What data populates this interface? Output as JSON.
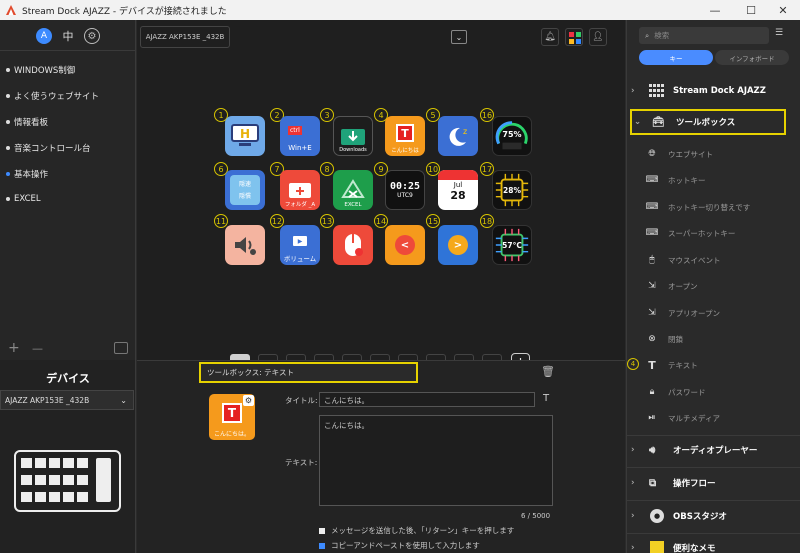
{
  "window": {
    "title": "Stream Dock AJAZZ - デバイスが接続されました",
    "min": "—",
    "max": "☐",
    "close": "✕"
  },
  "sidebar": {
    "items": [
      {
        "label": "WINDOWS制御",
        "active": false
      },
      {
        "label": "よく使うウェブサイト",
        "active": false
      },
      {
        "label": "情報看板",
        "active": false
      },
      {
        "label": "音楽コントロール台",
        "active": false
      },
      {
        "label": "基本操作",
        "active": true
      },
      {
        "label": "EXCEL",
        "active": false
      }
    ],
    "add": "+",
    "remove": "—"
  },
  "device_panel": {
    "heading": "デバイス",
    "device_select": "AJAZZ AKP153E _432B"
  },
  "toolbar": {
    "device_tab": "AJAZZ AKP153E _432B"
  },
  "keys": [
    {
      "num": "1",
      "label": ""
    },
    {
      "num": "2",
      "label": "Win+E",
      "top": "ctrl"
    },
    {
      "num": "3",
      "label": "Downloads"
    },
    {
      "num": "4",
      "label": "こんにちは",
      "glyph": "T"
    },
    {
      "num": "5",
      "label": ""
    },
    {
      "num": "16",
      "label": "75%"
    },
    {
      "num": "6",
      "label": "",
      "line1": "隠速",
      "line2": "隠慣"
    },
    {
      "num": "7",
      "label": "フォルダ _A"
    },
    {
      "num": "8",
      "label": "EXCEL"
    },
    {
      "num": "9",
      "label": "UTC9",
      "time": "00:25"
    },
    {
      "num": "10",
      "label": "28",
      "month": "Jul"
    },
    {
      "num": "17",
      "label": "28%"
    },
    {
      "num": "11",
      "label": ""
    },
    {
      "num": "12",
      "label": "ボリューム"
    },
    {
      "num": "13",
      "label": ""
    },
    {
      "num": "14",
      "label": "<"
    },
    {
      "num": "15",
      "label": ">"
    },
    {
      "num": "18",
      "label": "57°C"
    }
  ],
  "pages": [
    "1",
    "2",
    "3",
    "4",
    "5",
    "6",
    "7",
    "8",
    "9",
    "10"
  ],
  "page_add": "+",
  "editor": {
    "header": "ツールボックス: テキスト",
    "title_label": "タイトル:",
    "title_value": "こんにちは。",
    "text_label": "テキスト:",
    "text_value": "こんにちは。",
    "counter": "6 / 5000",
    "opt1": "メッセージを送信した後、「リターン」キーを押します",
    "opt2": "コピーアンドペーストを使用して入力します",
    "preview_label": "こんにちは。",
    "tbtn": "T"
  },
  "right": {
    "search_placeholder": "検索",
    "tab_key": "キー",
    "tab_info": "インフォボード",
    "sections": [
      "Stream Dock AJAZZ",
      "ツールボックス",
      "オーディオプレーヤー",
      "操作フロー",
      "OBSスタジオ",
      "便利なメモ"
    ],
    "tools": [
      "ウエブサイト",
      "ホットキー",
      "ホットキー切り替えです",
      "スーパーホットキー",
      "マウスイベント",
      "オープン",
      "アプリオープン",
      "閉鎖",
      "テキスト",
      "パスワード",
      "マルチメディア"
    ],
    "tool_badge": "4"
  },
  "colors": {
    "accent": "#e6d200",
    "active_tab": "#4a8cff"
  }
}
